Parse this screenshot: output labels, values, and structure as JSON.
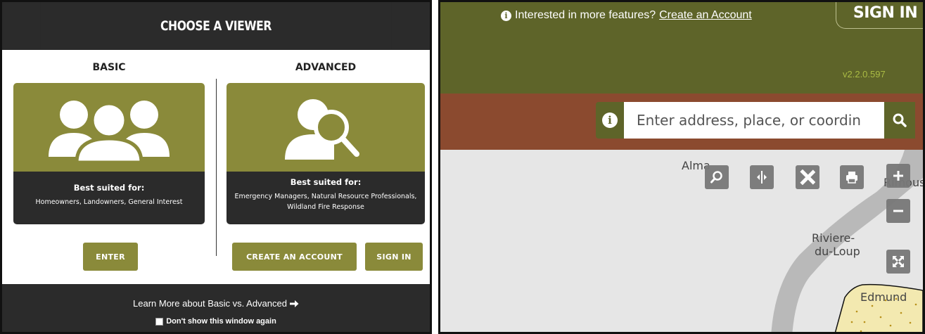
{
  "chooser": {
    "title": "CHOOSE A VIEWER",
    "basic": {
      "heading": "BASIC",
      "icon": "three-users-icon",
      "suited_title": "Best suited for:",
      "suited_text": "Homeowners, Landowners, General Interest",
      "enter_label": "ENTER"
    },
    "advanced": {
      "heading": "ADVANCED",
      "icon": "user-search-icon",
      "suited_title": "Best suited for:",
      "suited_line1": "Emergency Managers, Natural Resource Professionals,",
      "suited_line2": "Wildland Fire Response",
      "create_label": "CREATE AN ACCOUNT",
      "signin_label": "SIGN IN"
    },
    "footer": {
      "learn_more": "Learn More about Basic vs. Advanced",
      "dont_show": "Don't show this window again"
    },
    "colors": {
      "olive": "#8a8a3a",
      "dark": "#2b2b2b"
    }
  },
  "viewer": {
    "notice_text": "Interested in more features?",
    "notice_link": "Create an Account",
    "signin_label": "SIGN IN",
    "version": "v2.2.0.597",
    "search_placeholder": "Enter address, place, or coordin",
    "map_labels": {
      "alma": "Alma",
      "rimouski": "Rimous",
      "riviere_line1": "Riviere-",
      "riviere_line2": "du-Loup",
      "edmund": "Edmund"
    },
    "tools": [
      "zoom-search-icon",
      "swipe-compare-icon",
      "measure-tools-icon",
      "print-icon",
      "zoom-in-icon",
      "zoom-out-icon",
      "full-extent-icon"
    ],
    "colors": {
      "topbar": "#5e6429",
      "searchbar": "#8b4a2f",
      "version": "#aabb44",
      "map_bg": "#e6e6e6",
      "water": "#b9b9b9",
      "region": "#f3e9b0"
    }
  }
}
